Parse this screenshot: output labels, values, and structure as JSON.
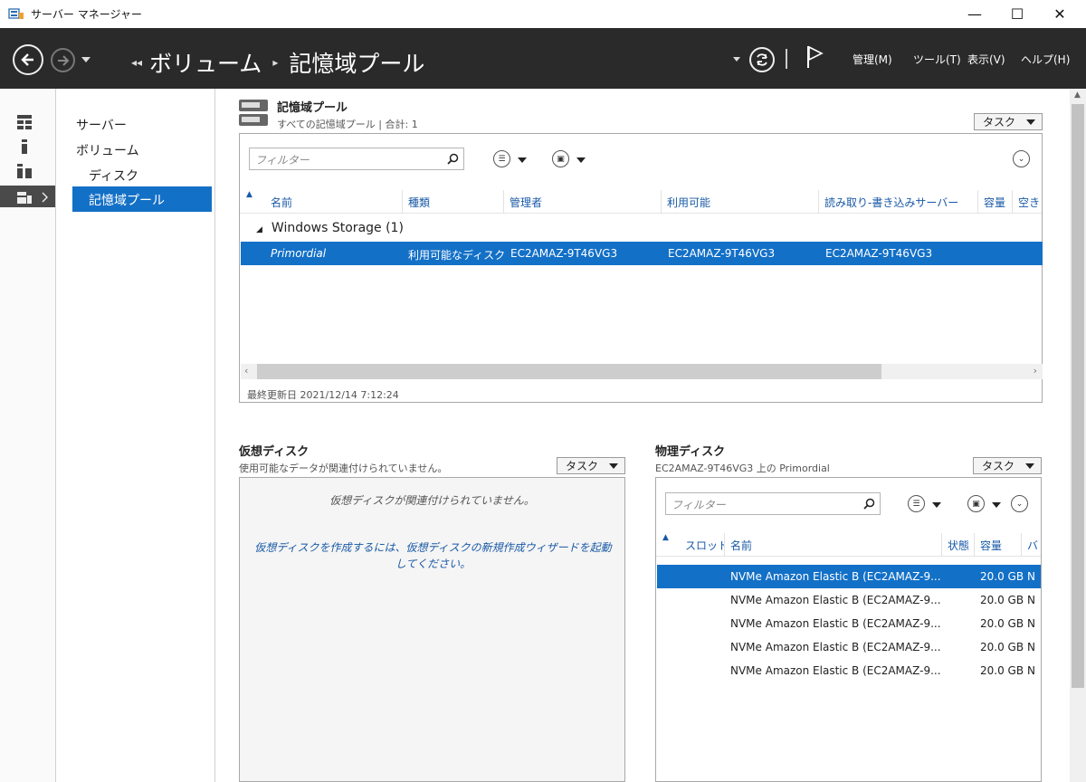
{
  "window": {
    "title": "サーバー マネージャー",
    "minimize": "—",
    "maximize": "☐",
    "close": "✕"
  },
  "header": {
    "breadcrumb": [
      "ボリューム",
      "記憶域プール"
    ],
    "menus": [
      "管理(M)",
      "ツール(T)",
      "表示(V)",
      "ヘルプ(H)"
    ]
  },
  "nav": {
    "items": [
      "サーバー",
      "ボリューム",
      "ディスク",
      "記憶域プール"
    ]
  },
  "pools": {
    "title": "記憶域プール",
    "subtitle": "すべての記憶域プール | 合計: 1",
    "task_label": "タスク",
    "filter_placeholder": "フィルター",
    "columns": [
      "名前",
      "種類",
      "管理者",
      "利用可能",
      "読み取り-書き込みサーバー",
      "容量",
      "空き"
    ],
    "group_label": "Windows Storage (1)",
    "rows": [
      {
        "name": "Primordial",
        "type": "利用可能なディスク",
        "manager": "EC2AMAZ-9T46VG3",
        "available": "EC2AMAZ-9T46VG3",
        "rw_server": "EC2AMAZ-9T46VG3"
      }
    ],
    "last_updated": "最終更新日 2021/12/14 7:12:24"
  },
  "virtual_disks": {
    "title": "仮想ディスク",
    "subtitle": "使用可能なデータが関連付けられていません。",
    "task_label": "タスク",
    "empty_message": "仮想ディスクが関連付けられていません。",
    "hint_message": "仮想ディスクを作成するには、仮想ディスクの新規作成ウィザードを起動してください。"
  },
  "physical_disks": {
    "title": "物理ディスク",
    "subtitle": "EC2AMAZ-9T46VG3 上の Primordial",
    "task_label": "タスク",
    "filter_placeholder": "フィルター",
    "columns": [
      "スロット",
      "名前",
      "状態",
      "容量",
      "バ"
    ],
    "rows": [
      {
        "name": "NVMe Amazon Elastic B (EC2AMAZ-9...",
        "capacity": "20.0 GB",
        "bus": "N"
      },
      {
        "name": "NVMe Amazon Elastic B (EC2AMAZ-9...",
        "capacity": "20.0 GB",
        "bus": "N"
      },
      {
        "name": "NVMe Amazon Elastic B (EC2AMAZ-9...",
        "capacity": "20.0 GB",
        "bus": "N"
      },
      {
        "name": "NVMe Amazon Elastic B (EC2AMAZ-9...",
        "capacity": "20.0 GB",
        "bus": "N"
      },
      {
        "name": "NVMe Amazon Elastic B (EC2AMAZ-9...",
        "capacity": "20.0 GB",
        "bus": "N"
      }
    ]
  },
  "colors": {
    "header_bg": "#2a2a2a",
    "selection": "#1370c7",
    "link_text": "#1a5aa6"
  }
}
